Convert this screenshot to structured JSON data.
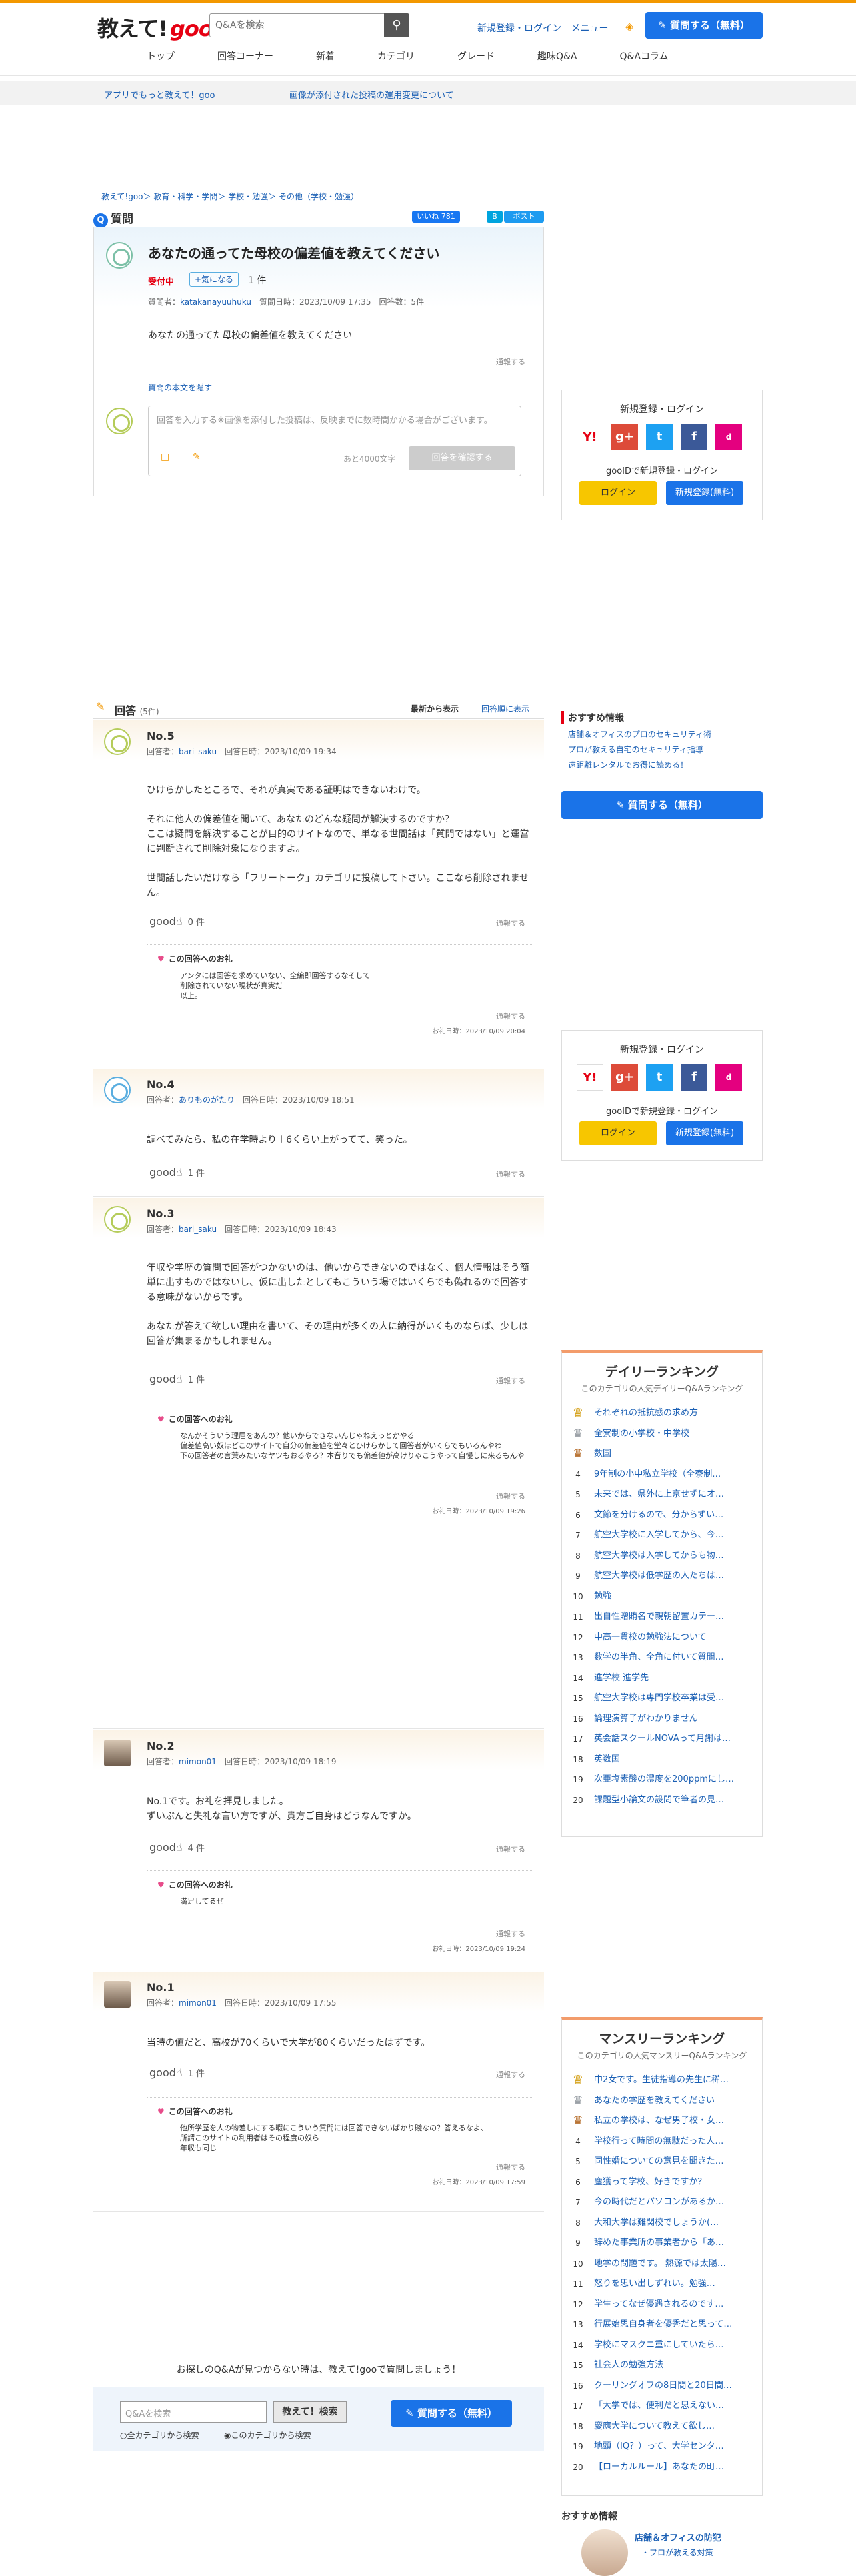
{
  "header": {
    "logo_text": "教えて!",
    "logo_goo": "goo",
    "search_placeholder": "Q&Aを検索",
    "links": [
      "新規登録・ログイン",
      "メニュー"
    ],
    "ask_button": "質問する（無料）",
    "nav": [
      "トップ",
      "回答コーナー",
      "新着",
      "カテゴリ",
      "グレード",
      "趣味Q&A",
      "Q&Aコラム"
    ]
  },
  "notice": {
    "left": "アプリでもっと教えて！goo",
    "right": "画像が添付された投稿の運用変更について"
  },
  "breadcrumb": "教えて!goo＞ 教育・科学・学問＞ 学校・勉強＞ その他（学校・勉強）",
  "question": {
    "section_label": "質問",
    "social": {
      "fb": "いいね 781",
      "tw": "ポスト"
    },
    "title": "あなたの通ってた母校の偏差値を教えてください",
    "status": "受付中",
    "kininaru": "気になる",
    "kininaru_count": "1 件",
    "meta_asker_label": "質問者：",
    "meta_asker": "katakanayuuhuku",
    "meta_rest": "質問日時：2023/10/09 17:35　回答数：5件",
    "body": "あなたの通ってた母校の偏差値を教えてください",
    "report": "通報する",
    "quote_link": "質問の本文を隠す",
    "reply_placeholder": "回答を入力する※画像を添付した投稿は、反映までに数時間かかる場合がございます。",
    "reply_count": "あと4000文字",
    "reply_confirm": "回答を確認する"
  },
  "answers_header": {
    "title": "回答",
    "count": "(5件)",
    "sort1": "最新から表示",
    "sort2": "回答順に表示"
  },
  "answers": [
    {
      "no": "No.5",
      "user_label": "回答者：",
      "user": "bari_saku",
      "date": "回答日時：2023/10/09 19:34",
      "body": "ひけらかしたところで、それが真実である証明はできないわけで。\n\nそれに他人の偏差値を聞いて、あなたのどんな疑問が解決するのですか？\nここは疑問を解決することが目的のサイトなので、単なる世間話は「質問ではない」と運営に判断されて削除対象になりますよ。\n\n世間話したいだけなら「フリートーク」カテゴリに投稿して下さい。ここなら削除されません。",
      "good_label": "good",
      "good_count": "0 件",
      "report": "通報する",
      "thanks_title": "この回答へのお礼",
      "thanks_text": "アンタには回答を求めていない、全編即回答するなそして\n削除されていない現状が真実だ\n以上。",
      "thanks_report": "通報する",
      "thanks_date": "お礼日時：2023/10/09 20:04"
    },
    {
      "no": "No.4",
      "user_label": "回答者：",
      "user": "ありものがたり",
      "date": "回答日時：2023/10/09 18:51",
      "body": "調べてみたら、私の在学時より＋6くらい上がってて、笑った。",
      "good_label": "good",
      "good_count": "1 件",
      "report": "通報する"
    },
    {
      "no": "No.3",
      "user_label": "回答者：",
      "user": "bari_saku",
      "date": "回答日時：2023/10/09 18:43",
      "body": "年収や学歴の質問で回答がつかないのは、他いからできないのではなく、個人情報はそう簡単に出すものではないし、仮に出したとしてもこういう場ではいくらでも偽れるので回答する意味がないからです。\n\nあなたが答えて欲しい理由を書いて、その理由が多くの人に納得がいくものならば、少しは回答が集まるかもしれません。",
      "good_label": "good",
      "good_count": "1 件",
      "report": "通報する",
      "thanks_title": "この回答へのお礼",
      "thanks_text": "なんかそういう理屈をあんの？他いからできないんじゃねえっとかやる\n偏差値高い奴ほどこのサイトで自分の偏差値を堂々とひけらかして回答者がいくらでもいるんやわ\n下の回答者の言葉みたいなヤツもおるやろ？本音りでも偏差値が高けりゃこうやって自慢しに来るもんや",
      "thanks_report": "通報する",
      "thanks_date": "お礼日時：2023/10/09 19:26"
    },
    {
      "no": "No.2",
      "user_label": "回答者：",
      "user": "mimon01",
      "date": "回答日時：2023/10/09 18:19",
      "body": "No.1です。お礼を拝見しました。\nずいぶんと失礼な言い方ですが、貴方ご自身はどうなんですか。",
      "good_label": "good",
      "good_count": "4 件",
      "report": "通報する",
      "thanks_title": "この回答へのお礼",
      "thanks_text": "満足してるぜ",
      "thanks_report": "通報する",
      "thanks_date": "お礼日時：2023/10/09 19:24"
    },
    {
      "no": "No.1",
      "user_label": "回答者：",
      "user": "mimon01",
      "date": "回答日時：2023/10/09 17:55",
      "body": "当時の値だと、高校が70くらいで大学が80くらいだったはずです。",
      "good_label": "good",
      "good_count": "1 件",
      "report": "通報する",
      "thanks_title": "この回答へのお礼",
      "thanks_text": "他所学歴を人の物差しにする暇にこういう質問には回答できないばかり賤なの？答えるなよ、\n所謂このサイトの利用者はその程度の奴ら\n年収も同じ",
      "thanks_report": "通報する",
      "thanks_date": "お礼日時：2023/10/09 17:59"
    }
  ],
  "login_box": {
    "title": "新規登録・ログイン",
    "sub": "gooIDで新規登録・ログイン",
    "sns": [
      "Y!",
      "g+",
      "t",
      "f",
      "d"
    ],
    "login": "ログイン",
    "register": "新規登録(無料)"
  },
  "osusume": {
    "title": "おすすめ情報",
    "items": [
      "店舗＆オフィスのプロのセキュリティ術",
      "プロが教える自宅のセキュリティ指導",
      "遠距離レンタルでお得に読める！"
    ]
  },
  "daily_ranking": {
    "title": "デイリーランキング",
    "sub": "このカテゴリの人気デイリーQ&Aランキング",
    "items": [
      "それぞれの抵抗感の求め方",
      "全寮制の小学校・中学校",
      "数国",
      "9年制の小中私立学校（全寮制…",
      "未来では、県外に上京せずにオ…",
      "文節を分けるので、分からずい…",
      "航空大学校に入学してから、今…",
      "航空大学校は入学してからも物…",
      "航空大学校は低学歴の人たちは…",
      "勉強",
      "出自性贈賄名で親朝留置カテー…",
      "中高一貫校の勉強法について",
      "数学の半角、全角に付いて質問…",
      "進学校 進学先",
      "航空大学校は専門学校卒業は受…",
      "論理演算子がわかりません",
      "英会話スクールNOVAって月謝は…",
      "英数国",
      "次亜塩素酸の濃度を200ppmにし…",
      "課題型小論文の設問で筆者の見…"
    ]
  },
  "monthly_ranking": {
    "title": "マンスリーランキング",
    "sub": "このカテゴリの人気マンスリーQ&Aランキング",
    "items": [
      "中2女です。生徒指導の先生に稀…",
      "あなたの学歴を教えてください",
      "私立の学校は、なぜ男子校・女…",
      "学校行って時間の無駄だった人…",
      "同性婚についての意見を聞きた…",
      "塵獲って学校、好きですか？",
      "今の時代だとパソコンがあるか…",
      "大和大学は難関校でしょうか(…",
      "辞めた事業所の事業者から「あ…",
      "地学の問題です。 熱源では太陽…",
      "怒りを思い出しずれい。勉強…",
      "学生ってなぜ優遇されるのです…",
      "行展始思自身者を優秀だと思って…",
      "学校にマスクニ重にしていたら…",
      "社会人の勉強方法",
      "クーリングオフの8日間と20日間…",
      "「大学では、便利だと思えない…",
      "慶應大学について教えて欲し…",
      "地頭（IQ？）って、大学センタ…",
      "【ローカルルール】あなたの町…"
    ]
  },
  "footer_search": {
    "lead": "お探しのQ&Aが見つからない時は、教えて!gooで質問しましょう！",
    "placeholder": "Q&Aを検索",
    "button": "教えて！検索",
    "radio_all": "全カテゴリから検索",
    "radio_cat": "このカテゴリから検索",
    "ask": "質問する（無料）"
  },
  "ad_bottom": {
    "title": "おすすめ情報",
    "t1": "店舗＆オフィスの防犯",
    "t2": "・プロが教える対策"
  }
}
